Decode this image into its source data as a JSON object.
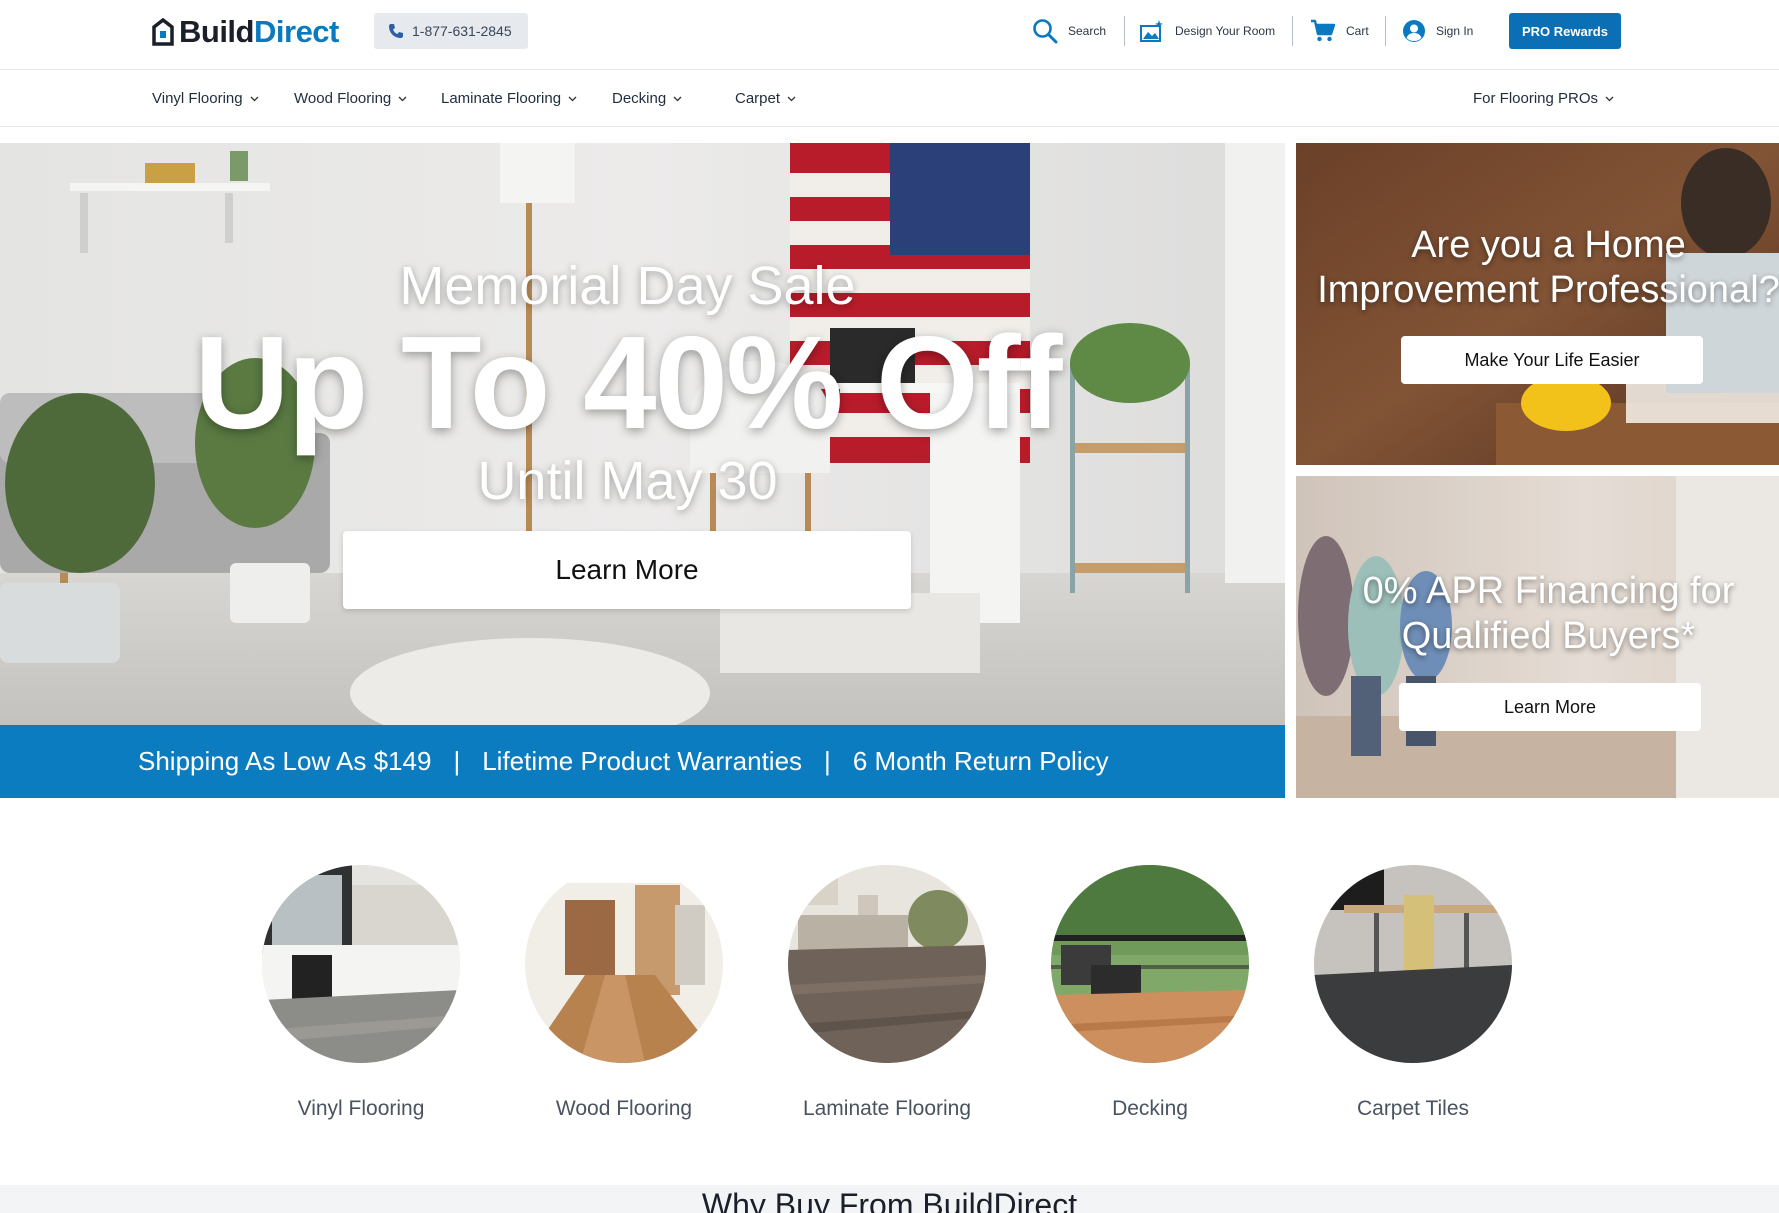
{
  "header": {
    "logo_part1": "Build",
    "logo_part2": "Direct",
    "phone": "1-877-631-2845",
    "search_label": "Search",
    "design_label": "Design Your Room",
    "cart_label": "Cart",
    "signin_label": "Sign In",
    "pro_rewards_label": "PRO Rewards"
  },
  "nav": {
    "items": [
      {
        "label": "Vinyl Flooring"
      },
      {
        "label": "Wood Flooring"
      },
      {
        "label": "Laminate Flooring"
      },
      {
        "label": "Decking"
      },
      {
        "label": "Carpet"
      }
    ],
    "pro_label": "For Flooring PROs"
  },
  "hero": {
    "subtitle": "Memorial Day Sale",
    "headline": "Up To 40% Off",
    "until": "Until May 30",
    "cta": "Learn More"
  },
  "banner": {
    "items": [
      "Shipping As Low As $149",
      "Lifetime Product Warranties",
      "6 Month Return Policy"
    ],
    "separator": "|"
  },
  "promos": [
    {
      "title_line1": "Are you a Home",
      "title_line2": "Improvement Professional?",
      "cta": "Make Your Life Easier"
    },
    {
      "title_line1": "0% APR Financing for",
      "title_line2": "Qualified Buyers*",
      "cta": "Learn More"
    }
  ],
  "categories": [
    {
      "label": "Vinyl Flooring"
    },
    {
      "label": "Wood Flooring"
    },
    {
      "label": "Laminate Flooring"
    },
    {
      "label": "Decking"
    },
    {
      "label": "Carpet Tiles"
    }
  ],
  "why": {
    "title": "Why Buy From BuildDirect"
  },
  "colors": {
    "brand_blue": "#0a79bf",
    "banner_blue": "#0b7cc0",
    "pro_button": "#0a6fb5"
  }
}
